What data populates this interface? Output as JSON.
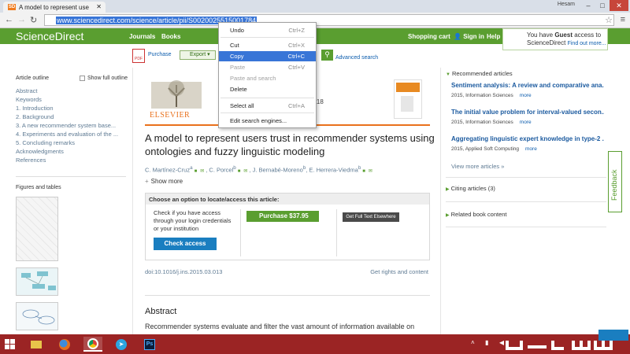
{
  "browser": {
    "tab_title": "A model to represent use",
    "tab_favicon": "SD",
    "user_name": "Hesam",
    "url": "www.sciencedirect.com/science/article/pii/S0020025515001784"
  },
  "sd_header": {
    "logo": "ScienceDirect",
    "nav": [
      "Journals",
      "Books",
      "Shopping cart",
      "Sign in",
      "Help"
    ],
    "guest_line1": "You have",
    "guest_strong": "Guest",
    "guest_line1b": "access to",
    "guest_line2": "ScienceDirect",
    "guest_link": "Find out more..."
  },
  "action_bar": {
    "purchase": "Purchase",
    "export": "Export",
    "advanced_search": "Advanced search"
  },
  "outline": {
    "title": "Article outline",
    "show_full": "Show full outline",
    "items": [
      "Abstract",
      "Keywords",
      "1. Introduction",
      "2. Background",
      "3. A new recommender system base...",
      "4. Experiments and evaluation of the ...",
      "5. Concluding remarks",
      "Acknowledgments",
      "References"
    ],
    "figures_title": "Figures and tables"
  },
  "article": {
    "publisher": "ELSEVIER",
    "journal_title_partial": "ces",
    "journal_volume_partial": "s 102–118",
    "title": "A model to represent users trust in recommender systems using ontologies and fuzzy linguistic modeling",
    "authors": [
      "C. Martínez-Cruz",
      "C. Porcel",
      "J. Bernabé-Moreno",
      "E. Herrera-Viedma"
    ],
    "author_superscripts": [
      "a",
      "b",
      "b",
      "b"
    ],
    "show_more": "Show more",
    "access_header": "Choose an option to locate/access this article:",
    "access_text": "Check if you have access through your login credentials or your institution",
    "check_access": "Check access",
    "purchase_price": "Purchase $37.95",
    "get_full_text": "Get Full Text Elsewhere",
    "doi": "doi:10.1016/j.ins.2015.03.013",
    "rights": "Get rights and content",
    "abstract_heading": "Abstract",
    "abstract_text": "Recommender systems evaluate and filter the vast amount of information available on"
  },
  "right_column": {
    "recommended_title": "Recommended articles",
    "items": [
      {
        "title": "Sentiment analysis: A review and comparative ana...",
        "meta": "2015, Information Sciences",
        "more": "more"
      },
      {
        "title": "The initial value problem for interval-valued secon...",
        "meta": "2015, Information Sciences",
        "more": "more"
      },
      {
        "title": "Aggregating linguistic expert knowledge in type-2 ...",
        "meta": "2015, Applied Soft Computing",
        "more": "more"
      }
    ],
    "view_more": "View more articles »",
    "citing": "Citing articles (3)",
    "related": "Related book content",
    "feedback": "Feedback"
  },
  "context_menu": [
    {
      "label": "Undo",
      "shortcut": "Ctrl+Z",
      "state": "normal"
    },
    {
      "label": "Cut",
      "shortcut": "Ctrl+X",
      "state": "normal"
    },
    {
      "label": "Copy",
      "shortcut": "Ctrl+C",
      "state": "highlighted"
    },
    {
      "label": "Paste",
      "shortcut": "Ctrl+V",
      "state": "disabled"
    },
    {
      "label": "Paste and search",
      "shortcut": "",
      "state": "disabled"
    },
    {
      "label": "Delete",
      "shortcut": "",
      "state": "normal"
    },
    {
      "label": "Select all",
      "shortcut": "Ctrl+A",
      "state": "normal"
    },
    {
      "label": "Edit search engines...",
      "shortcut": "",
      "state": "normal"
    }
  ],
  "taskbar": {
    "apps": [
      "file-explorer",
      "firefox",
      "chrome",
      "telegram",
      "photoshop"
    ],
    "ps_label": "Ps"
  },
  "colors": {
    "sd_green": "#5a9e30",
    "elsevier_orange": "#e9711c",
    "link_blue": "#1b5a9f",
    "taskbar_red": "#9b2424",
    "selection_blue": "#3875d7"
  }
}
